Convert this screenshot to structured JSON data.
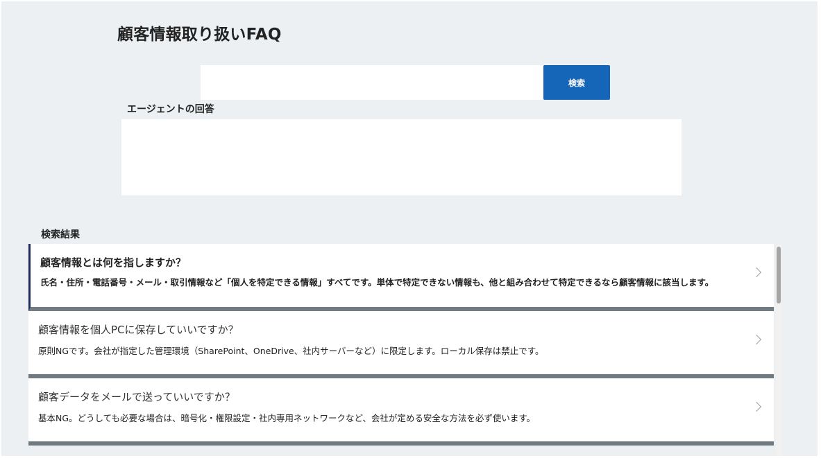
{
  "page": {
    "title": "顧客情報取り扱いFAQ"
  },
  "search": {
    "value": "",
    "placeholder": "",
    "button_label": "検索"
  },
  "answer": {
    "heading": "エージェントの回答",
    "text": ""
  },
  "results": {
    "heading": "検索結果",
    "items": [
      {
        "question": "顧客情報とは何を指しますか？",
        "answer": "氏名・住所・電話番号・メール・取引情報など「個人を特定できる情報」すべてです。単体で特定できない情報も、他と組み合わせて特定できるなら顧客情報に該当します。"
      },
      {
        "question": "顧客情報を個人PCに保存していいですか？",
        "answer": "原則NGです。会社が指定した管理環境（SharePoint、OneDrive、社内サーバーなど）に限定します。ローカル保存は禁止です。"
      },
      {
        "question": "顧客データをメールで送っていいですか？",
        "answer": "基本NG。どうしても必要な場合は、暗号化・権限設定・社内専用ネットワークなど、会社が定める安全な方法を必ず使います。"
      }
    ]
  },
  "colors": {
    "background": "#ecf0f2",
    "accent": "#1565b8",
    "active_marker": "#1f2a5c",
    "item_separator": "#6f7b80"
  }
}
